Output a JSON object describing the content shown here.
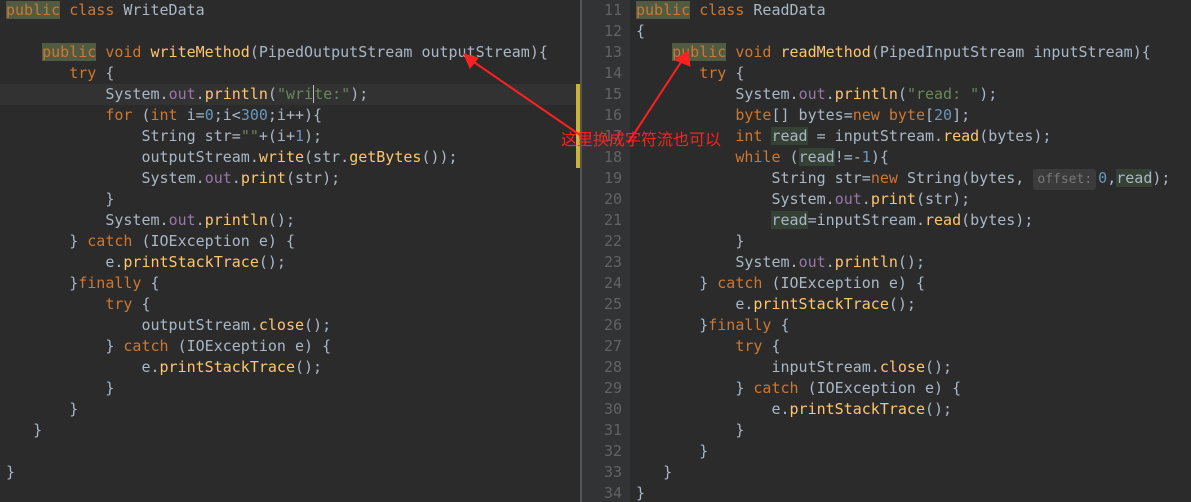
{
  "annotation": {
    "text": "这里换成字符流也可以"
  },
  "left": {
    "lines": [
      "<span class='kw-hl'>public</span> <span class='kw'>class</span> <span class='cls'>WriteData</span>",
      "",
      "    <span class='kw-hl'>public</span> <span class='kw'>void</span> <span class='meth'>writeMethod</span>(<span class='type'>PipedOutputStream</span> <span class='param'>outputStream</span>){",
      "       <span class='kw'>try</span> {",
      "           <span class='cls'>System</span>.<span class='field'>out</span>.<span class='meth'>println</span>(<span class='str'>\"wri<span class='caret'></span>te:\"</span>);",
      "           <span class='kw'>for</span> (<span class='kw'>int</span> i=<span class='num'>0</span>;i&lt;<span class='num'>300</span>;i++){",
      "               <span class='type'>String</span> str=<span class='str'>\"\"</span>+(i+<span class='num'>1</span>);",
      "               outputStream.<span class='meth'>write</span>(str.<span class='meth'>getBytes</span>());",
      "               <span class='cls'>System</span>.<span class='field'>out</span>.<span class='meth'>print</span>(str);",
      "           }",
      "           <span class='cls'>System</span>.<span class='field'>out</span>.<span class='meth'>println</span>();",
      "       } <span class='kw'>catch</span> (<span class='type'>IOException</span> e) {",
      "           e.<span class='meth'>printStackTrace</span>();",
      "       }<span class='kw'>finally</span> {",
      "           <span class='kw'>try</span> {",
      "               outputStream.<span class='meth'>close</span>();",
      "           } <span class='kw'>catch</span> (<span class='type'>IOException</span> e) {",
      "               e.<span class='meth'>printStackTrace</span>();",
      "           }",
      "       }",
      "   }",
      "",
      "}"
    ],
    "currentLine": 4
  },
  "right": {
    "startLine": 11,
    "lines": [
      "<span class='kw-hl'>public</span> <span class='kw'>class</span> <span class='cls'>ReadData</span>",
      "{",
      "    <span class='kw-hl'>public</span> <span class='kw'>void</span> <span class='meth'>readMethod</span>(<span class='type'>PipedInputStream</span> <span class='param'>inputStream</span>){",
      "       <span class='kw'>try</span> {",
      "           <span class='cls'>System</span>.<span class='field'>out</span>.<span class='meth'>println</span>(<span class='str'>\"read: \"</span>);",
      "           <span class='kw'>byte</span>[] bytes=<span class='kw'>new</span> <span class='kw'>byte</span>[<span class='num'>20</span>];",
      "           <span class='kw'>int</span> <span class='hlvar'>read</span> = inputStream.<span class='meth'>read</span>(bytes);",
      "           <span class='kw'>while</span> (<span class='hlvar'>read</span>!=-<span class='num'>1</span>){",
      "               <span class='type'>String</span> str=<span class='kw'>new</span> <span class='type'>String</span>(bytes, <span class='hint'>offset:</span><span class='num'>0</span>,<span class='hlvar'>read</span>);",
      "               <span class='cls'>System</span>.<span class='field'>out</span>.<span class='meth'>print</span>(str);",
      "               <span class='hlvar'>read</span>=inputStream.<span class='meth'>read</span>(bytes);",
      "           }",
      "           <span class='cls'>System</span>.<span class='field'>out</span>.<span class='meth'>println</span>();",
      "       } <span class='kw'>catch</span> (<span class='type'>IOException</span> e) {",
      "           e.<span class='meth'>printStackTrace</span>();",
      "       }<span class='kw'>finally</span> {",
      "           <span class='kw'>try</span> {",
      "               inputStream.<span class='meth'>close</span>();",
      "           } <span class='kw'>catch</span> (<span class='type'>IOException</span> e) {",
      "               e.<span class='meth'>printStackTrace</span>();",
      "           }",
      "       }",
      "   }",
      "}"
    ]
  }
}
